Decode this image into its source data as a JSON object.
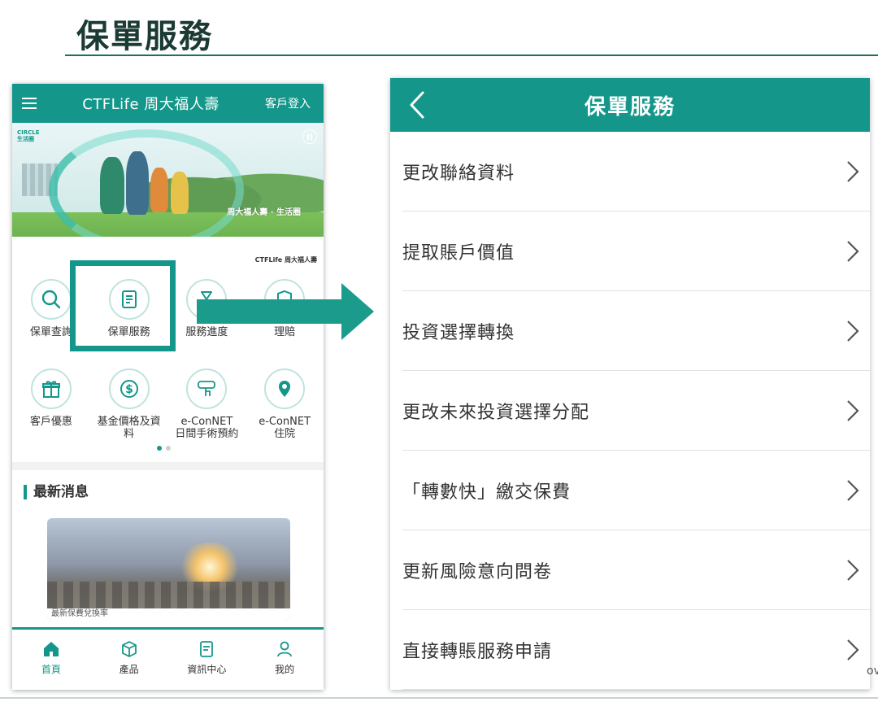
{
  "slide": {
    "title": "保單服務",
    "edge_fragment": "ov"
  },
  "colors": {
    "brand_teal": "#14978a",
    "title_dark": "#1a3a33"
  },
  "phone": {
    "header": {
      "menu_icon": "hamburger-icon",
      "logo": "CTFLife 周大福人壽",
      "login": "客戶登入"
    },
    "banner": {
      "badge_line1": "CIRCLE",
      "badge_line2": "生活圈",
      "caption": "周大福人壽 · 生活圈",
      "mini_logo": "CTFLife 周大福人壽"
    },
    "services_row1": [
      {
        "label": "保單查詢",
        "icon": "search-icon"
      },
      {
        "label": "保單服務",
        "icon": "policy-document-icon"
      },
      {
        "label": "服務進度",
        "icon": "hourglass-icon"
      },
      {
        "label": "理賠",
        "icon": "shield-icon"
      }
    ],
    "services_row2": [
      {
        "label": "客戶優惠",
        "icon": "gift-icon"
      },
      {
        "label": "基金價格及資\n料",
        "icon": "dollar-icon"
      },
      {
        "label": "e-ConNET\n日間手術預約",
        "icon": "book-tap-icon"
      },
      {
        "label": "e-ConNET\n住院",
        "icon": "location-pin-icon"
      }
    ],
    "news": {
      "title": "最新消息",
      "card_caption": "最新保費兌換率"
    },
    "tabs": [
      {
        "label": "首頁",
        "icon": "home-icon",
        "active": true
      },
      {
        "label": "產品",
        "icon": "box-icon",
        "active": false
      },
      {
        "label": "資訊中心",
        "icon": "document-icon",
        "active": false
      },
      {
        "label": "我的",
        "icon": "user-icon",
        "active": false
      }
    ]
  },
  "panel": {
    "back_icon": "chevron-left-icon",
    "title": "保單服務",
    "items": [
      "更改聯絡資料",
      "提取賬戶價值",
      "投資選擇轉換",
      "更改未來投資選擇分配",
      "「轉數快」繳交保費",
      "更新風險意向問卷",
      "直接轉賬服務申請"
    ]
  }
}
